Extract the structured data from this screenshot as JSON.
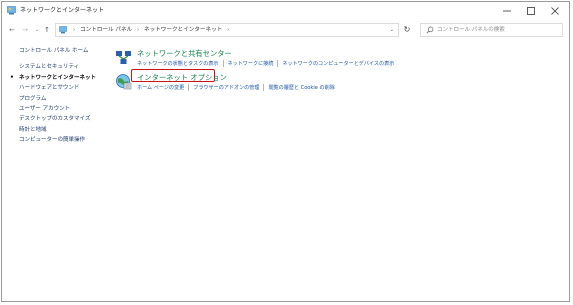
{
  "window": {
    "title": "ネットワークとインターネット",
    "icon": "control-panel-icon",
    "controls": {
      "minimize": "minimize-icon",
      "maximize": "maximize-icon",
      "close": "close-icon"
    }
  },
  "address_bar": {
    "crumbs": [
      "コントロール パネル",
      "ネットワークとインターネット"
    ],
    "search_placeholder": "コントロール パネルの検索"
  },
  "sidebar": {
    "items": [
      {
        "label": "コントロール パネル ホーム",
        "active": false
      },
      {
        "label": "システムとセキュリティ",
        "active": false
      },
      {
        "label": "ネットワークとインターネット",
        "active": true
      },
      {
        "label": "ハードウェアとサウンド",
        "active": false
      },
      {
        "label": "プログラム",
        "active": false
      },
      {
        "label": "ユーザー アカウント",
        "active": false
      },
      {
        "label": "デスクトップのカスタマイズ",
        "active": false
      },
      {
        "label": "時計と地域",
        "active": false
      },
      {
        "label": "コンピューターの簡単操作",
        "active": false
      }
    ]
  },
  "categories": [
    {
      "title": "ネットワークと共有センター",
      "icon": "network-sharing-center-icon",
      "links": [
        "ネットワークの状態とタスクの表示",
        "ネットワークに接続",
        "ネットワークのコンピューターとデバイスの表示"
      ]
    },
    {
      "title": "インターネット オプション",
      "icon": "internet-options-icon",
      "highlighted": true,
      "highlight_color": "#cc1212",
      "links": [
        "ホーム ページの変更",
        "ブラウザーのアドオンの管理",
        "閲覧の履歴と Cookie の削除"
      ]
    }
  ],
  "colors": {
    "category_title": "#12814a",
    "link": "#1a55a6",
    "sidebar_link": "#1a3a6e"
  }
}
